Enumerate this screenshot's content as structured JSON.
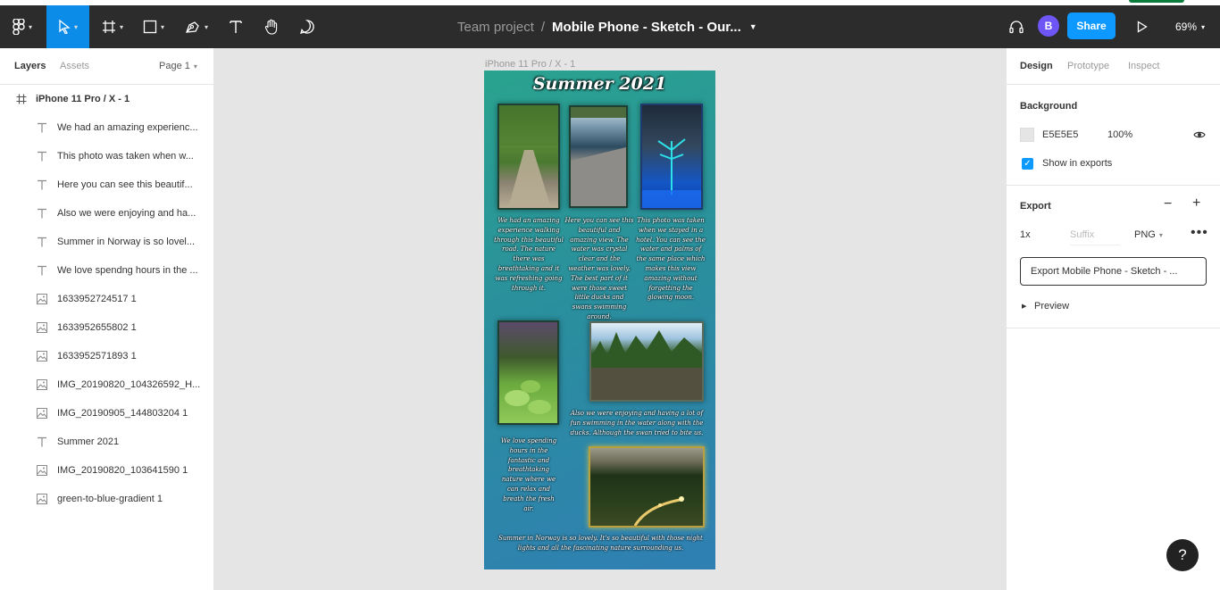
{
  "toolbar": {
    "team": "Team project",
    "separator": "/",
    "file_name": "Mobile Phone - Sketch - Our...",
    "avatar_initial": "B",
    "share_label": "Share",
    "zoom": "69%"
  },
  "left_panel": {
    "tabs": [
      "Layers",
      "Assets"
    ],
    "page": "Page 1",
    "frame": "iPhone 11 Pro / X - 1",
    "layers": [
      {
        "type": "text",
        "name": "We had an amazing experienc..."
      },
      {
        "type": "text",
        "name": "This photo was taken when w..."
      },
      {
        "type": "text",
        "name": "Here you can see this beautif..."
      },
      {
        "type": "text",
        "name": "Also we were enjoying and ha..."
      },
      {
        "type": "text",
        "name": "Summer in Norway is so lovel..."
      },
      {
        "type": "text",
        "name": "We love spendng hours in the ..."
      },
      {
        "type": "image",
        "name": "1633952724517 1"
      },
      {
        "type": "image",
        "name": "1633952655802 1"
      },
      {
        "type": "image",
        "name": "1633952571893 1"
      },
      {
        "type": "image",
        "name": "IMG_20190820_104326592_H..."
      },
      {
        "type": "image",
        "name": "IMG_20190905_144803204 1"
      },
      {
        "type": "text",
        "name": "Summer 2021"
      },
      {
        "type": "image",
        "name": "IMG_20190820_103641590 1"
      },
      {
        "type": "image",
        "name": "green-to-blue-gradient 1"
      }
    ]
  },
  "canvas": {
    "frame_label": "iPhone 11 Pro / X - 1",
    "title": "Summer 2021",
    "captions": {
      "c1": "We had an amazing experience walking through this beautiful road. The nature there was breathtaking and it was refreshing going through it.",
      "c2": "Here you can see this beautiful and amazing view. The water was crystal clear and the weather was lovely. The best part of it were those sweet little ducks and swans swimming around.",
      "c3": "This photo was taken when we stayed in a hotel. You can see the water and palms of the same place which makes this view amazing without forgetting the glowing moon.",
      "c4": "Also we were enjoying and having a lot of fun swimming in the water along with the ducks. Although the swan tried to bite us.",
      "c5": "We love spending hours in the fantastic and breathtaking nature where we can relax and breath the fresh air.",
      "c6": "Summer in Norway is so lovely. It's so beautiful with those night lights and all the fascinating nature surrounding us."
    }
  },
  "right_panel": {
    "tabs": [
      "Design",
      "Prototype",
      "Inspect"
    ],
    "background": {
      "title": "Background",
      "hex": "E5E5E5",
      "opacity": "100%",
      "show_in_exports": "Show in exports"
    },
    "export": {
      "title": "Export",
      "scale": "1x",
      "suffix_placeholder": "Suffix",
      "format": "PNG",
      "button": "Export Mobile Phone - Sketch - ...",
      "preview": "Preview"
    }
  },
  "help": "?"
}
